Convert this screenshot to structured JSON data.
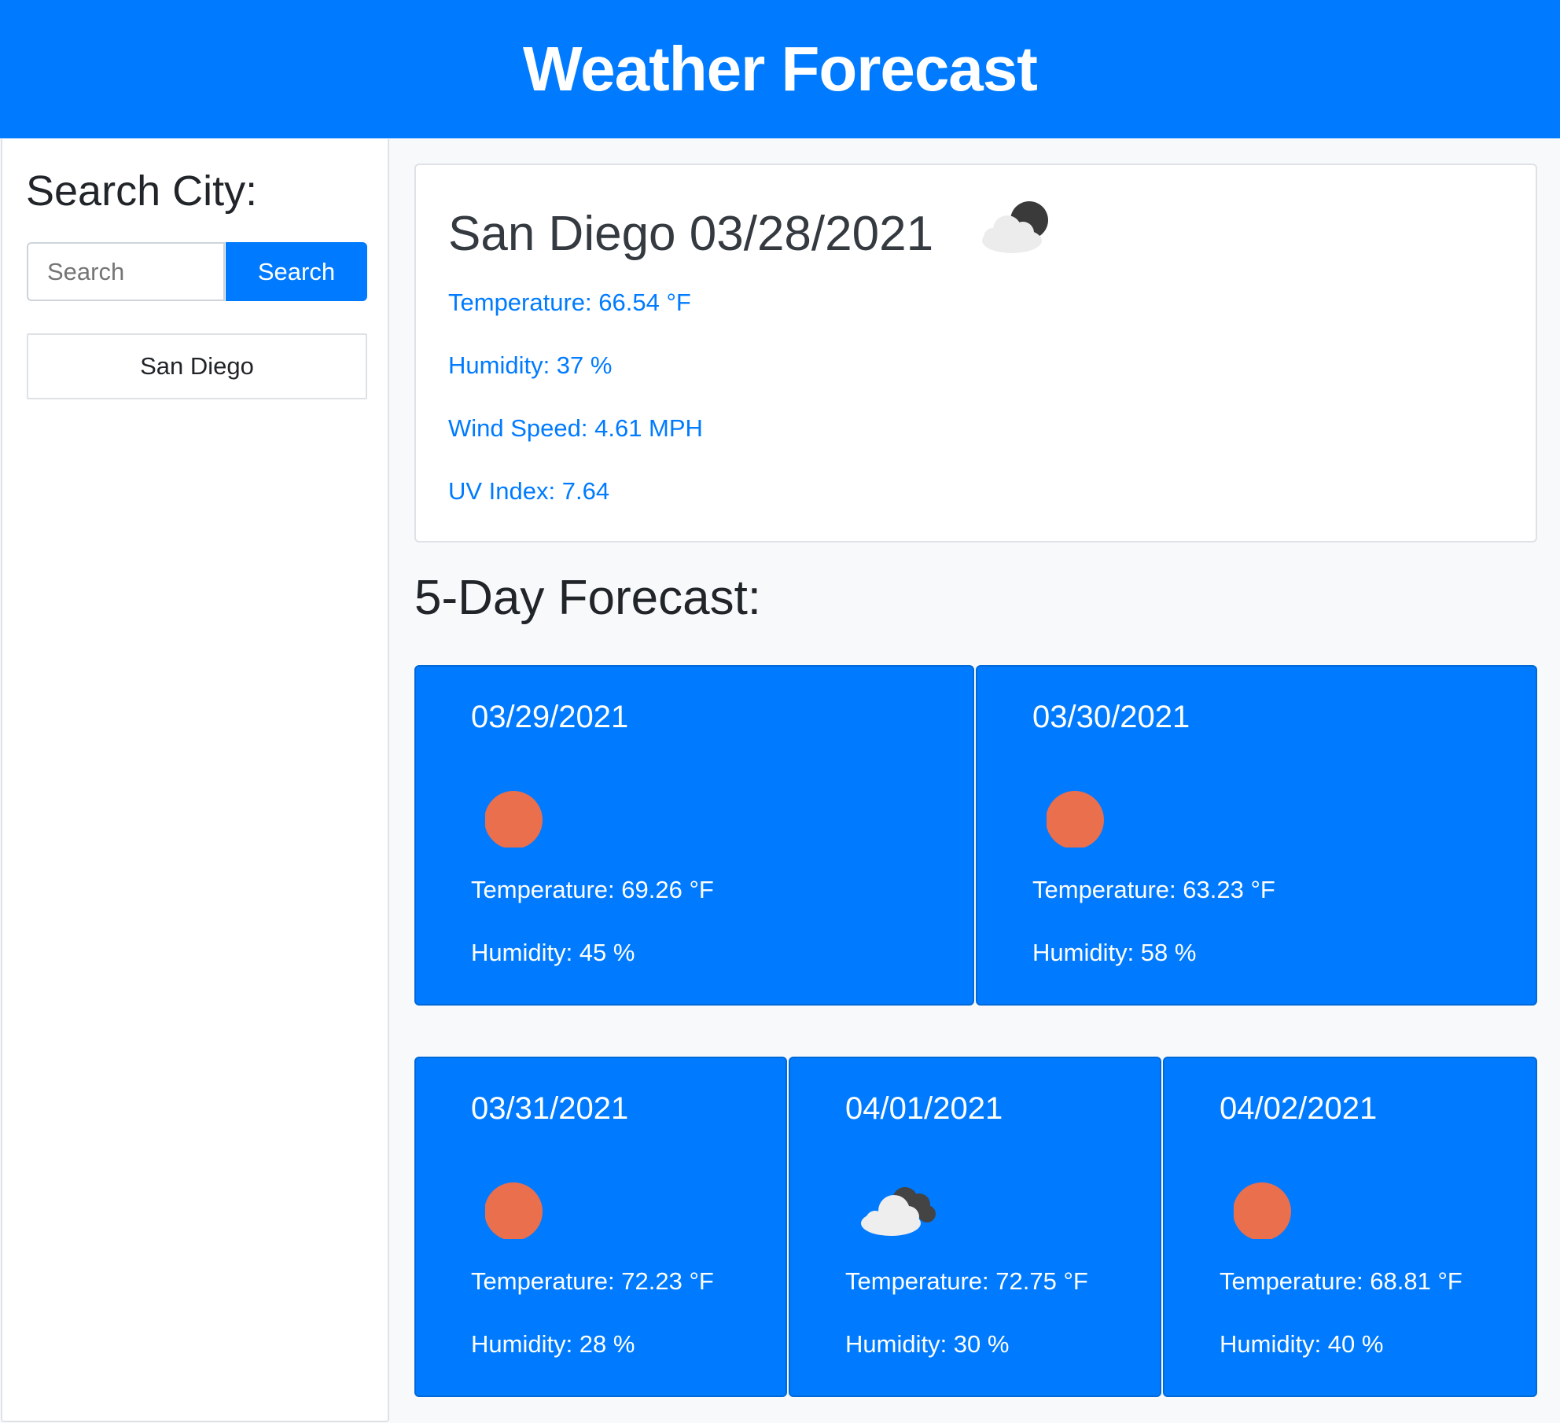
{
  "header": {
    "title": "Weather Forecast"
  },
  "sidebar": {
    "heading": "Search City:",
    "search": {
      "placeholder": "Search",
      "value": "",
      "button_label": "Search"
    },
    "history": [
      "San Diego"
    ]
  },
  "current": {
    "title": "San Diego 03/28/2021",
    "icon": "cloud-night-icon",
    "temperature": "Temperature: 66.54 °F",
    "humidity": "Humidity: 37 %",
    "wind": "Wind Speed: 4.61 MPH",
    "uv": "UV Index: 7.64"
  },
  "forecast": {
    "heading": "5-Day Forecast:",
    "days": [
      {
        "date": "03/29/2021",
        "icon": "sun-icon",
        "temperature": "Temperature: 69.26 °F",
        "humidity": "Humidity: 45 %"
      },
      {
        "date": "03/30/2021",
        "icon": "sun-icon",
        "temperature": "Temperature: 63.23 °F",
        "humidity": "Humidity: 58 %"
      },
      {
        "date": "03/31/2021",
        "icon": "sun-icon",
        "temperature": "Temperature: 72.23 °F",
        "humidity": "Humidity: 28 %"
      },
      {
        "date": "04/01/2021",
        "icon": "cloudy-icon",
        "temperature": "Temperature: 72.75 °F",
        "humidity": "Humidity: 30 %"
      },
      {
        "date": "04/02/2021",
        "icon": "sun-icon",
        "temperature": "Temperature: 68.81 °F",
        "humidity": "Humidity: 40 %"
      }
    ]
  },
  "colors": {
    "primary": "#007bff",
    "sun": "#ea6f4c",
    "cloud": "#f0f0f0",
    "cloud_dark": "#444444"
  }
}
